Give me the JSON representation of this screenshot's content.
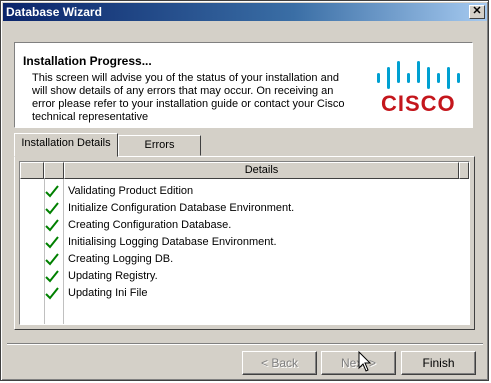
{
  "window": {
    "title": "Database Wizard",
    "close_glyph": "✕"
  },
  "header": {
    "title": "Installation Progress...",
    "description": "This screen will advise you of the status of your installation and will show details of any errors that may occur. On receiving an error please refer to your installation guide or contact your Cisco technical representative",
    "logo_text": "CISCO",
    "logo_color": "#c4161c"
  },
  "tabs": [
    {
      "label": "Installation Details",
      "active": true
    },
    {
      "label": "Errors",
      "active": false
    }
  ],
  "grid": {
    "columns": [
      "",
      "",
      "Details"
    ],
    "rows": [
      {
        "status": "check-icon",
        "detail": "Validating Product Edition"
      },
      {
        "status": "check-icon",
        "detail": "Initialize Configuration Database Environment."
      },
      {
        "status": "check-icon",
        "detail": "Creating Configuration Database."
      },
      {
        "status": "check-icon",
        "detail": "Initialising Logging Database Environment."
      },
      {
        "status": "check-icon",
        "detail": "Creating Logging DB."
      },
      {
        "status": "check-icon",
        "detail": "Updating Registry."
      },
      {
        "status": "check-icon",
        "detail": "Updating Ini File"
      }
    ],
    "check_color": "#008000"
  },
  "buttons": {
    "back": "< Back",
    "next": "Next >",
    "finish": "Finish"
  }
}
